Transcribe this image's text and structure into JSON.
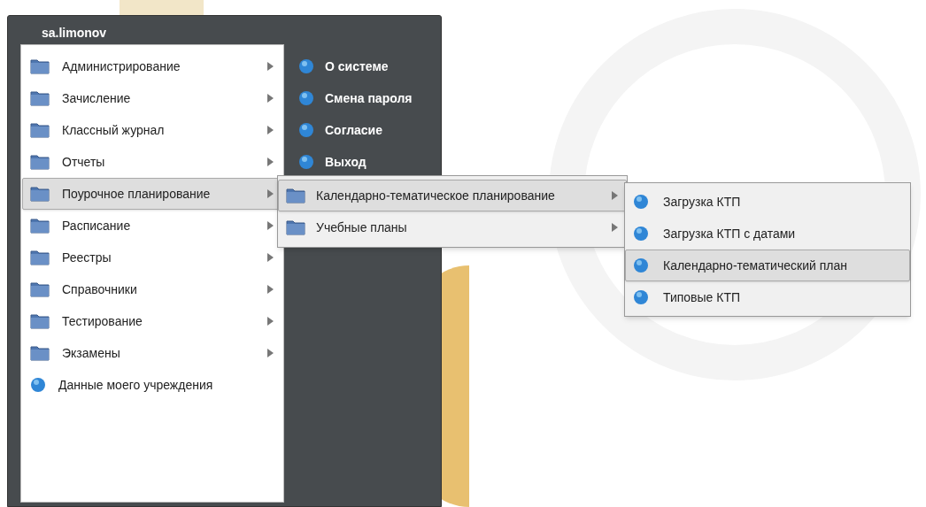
{
  "user": {
    "name": "sa.limonov"
  },
  "main_menu": [
    {
      "label": "Администрирование",
      "kind": "folder",
      "selected": false
    },
    {
      "label": "Зачисление",
      "kind": "folder",
      "selected": false
    },
    {
      "label": "Классный журнал",
      "kind": "folder",
      "selected": false
    },
    {
      "label": "Отчеты",
      "kind": "folder",
      "selected": false
    },
    {
      "label": "Поурочное планирование",
      "kind": "folder",
      "selected": true
    },
    {
      "label": "Расписание",
      "kind": "folder",
      "selected": false
    },
    {
      "label": "Реестры",
      "kind": "folder",
      "selected": false
    },
    {
      "label": "Справочники",
      "kind": "folder",
      "selected": false
    },
    {
      "label": "Тестирование",
      "kind": "folder",
      "selected": false
    },
    {
      "label": "Экзамены",
      "kind": "folder",
      "selected": false
    },
    {
      "label": "Данные моего учреждения",
      "kind": "leaf",
      "selected": false
    }
  ],
  "user_links": [
    "О системе",
    "Смена пароля",
    "Согласие",
    "Выход"
  ],
  "submenu": [
    {
      "label": "Календарно-тематическое планирование",
      "kind": "folder",
      "selected": true
    },
    {
      "label": "Учебные планы",
      "kind": "folder",
      "selected": false
    }
  ],
  "submenu_2": [
    {
      "label": "Загрузка КТП",
      "kind": "leaf",
      "selected": false
    },
    {
      "label": "Загрузка КТП с датами",
      "kind": "leaf",
      "selected": false
    },
    {
      "label": "Календарно-тематический план",
      "kind": "leaf",
      "selected": true
    },
    {
      "label": "Типовые КТП",
      "kind": "leaf",
      "selected": false
    }
  ]
}
